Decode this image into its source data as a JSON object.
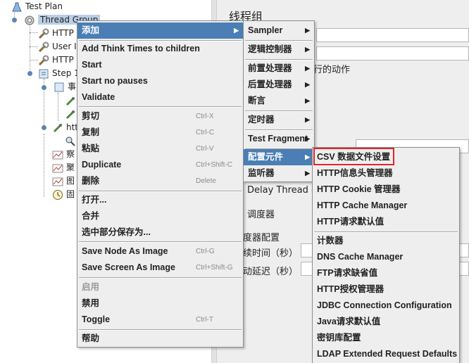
{
  "tree": {
    "test_plan": "Test Plan",
    "thread_group": "Thread Group",
    "items": [
      "HTTP",
      "User I",
      "HTTP",
      "Step 1",
      "事",
      "htt",
      "察",
      "聚",
      "图",
      "固"
    ]
  },
  "right": {
    "title": "线程组",
    "action_suffix": "行的动作",
    "delay_thread": "Delay Thread cr",
    "scheduler": "调度器",
    "scheduler_config": "度器配置",
    "duration": "续时间（秒）",
    "startup_delay": "动延迟（秒）"
  },
  "main_menu": {
    "add": "添加",
    "add_think_times": "Add Think Times to children",
    "start": "Start",
    "start_no_pauses": "Start no pauses",
    "validate": "Validate",
    "cut": "剪切",
    "cut_sc": "Ctrl-X",
    "copy": "复制",
    "copy_sc": "Ctrl-C",
    "paste": "粘贴",
    "paste_sc": "Ctrl-V",
    "duplicate": "Duplicate",
    "duplicate_sc": "Ctrl+Shift-C",
    "delete": "删除",
    "delete_sc": "Delete",
    "open": "打开...",
    "merge": "合并",
    "save_selection": "选中部分保存为...",
    "save_node_image": "Save Node As Image",
    "save_node_image_sc": "Ctrl-G",
    "save_screen_image": "Save Screen As Image",
    "save_screen_image_sc": "Ctrl+Shift-G",
    "enable": "启用",
    "disable": "禁用",
    "toggle": "Toggle",
    "toggle_sc": "Ctrl-T",
    "help": "帮助"
  },
  "add_menu": {
    "sampler": "Sampler",
    "logic_controller": "逻辑控制器",
    "pre_processors": "前置处理器",
    "post_processors": "后置处理器",
    "assertions": "断言",
    "timer": "定时器",
    "test_fragment": "Test Fragment",
    "config_element": "配置元件",
    "listener": "监听器"
  },
  "config_menu": {
    "csv": "CSV 数据文件设置",
    "http_header": "HTTP信息头管理器",
    "http_cookie": "HTTP Cookie 管理器",
    "http_cache": "HTTP Cache Manager",
    "http_defaults": "HTTP请求默认值",
    "counter": "计数器",
    "dns_cache": "DNS Cache Manager",
    "ftp_defaults": "FTP请求缺省值",
    "http_auth": "HTTP授权管理器",
    "jdbc": "JDBC Connection Configuration",
    "java_defaults": "Java请求默认值",
    "keystore": "密钥库配置",
    "ldap_ext": "LDAP Extended Request Defaults"
  },
  "colors": {
    "highlight": "#4a7eb4",
    "menu_bg": "#eeeeee",
    "red_box": "#e0262c"
  }
}
